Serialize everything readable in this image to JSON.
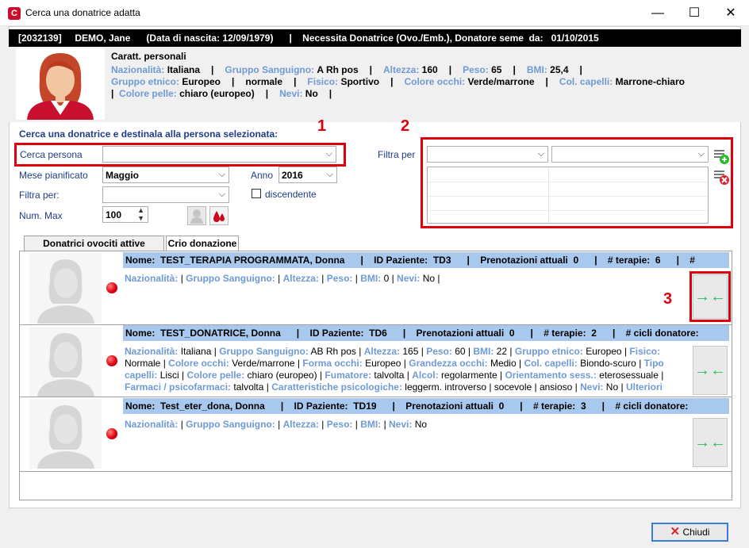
{
  "window": {
    "title": "Cerca una donatrice adatta",
    "minimize": "—",
    "maximize": "☐",
    "close": "✕"
  },
  "header": {
    "text": "[2032139]     DEMO, Jane      (Data di nascita: 12/09/1979)      |    Necessita Donatrice (Ovo./Emb.), Donatore seme  da:   01/10/2015"
  },
  "person": {
    "title": "Caratt. personali",
    "nazionalita_label": "Nazionalità:",
    "nazionalita": "Italiana",
    "gruppo_label": "Gruppo Sanguigno:",
    "gruppo": "A Rh pos",
    "altezza_label": "Altezza:",
    "altezza": "160",
    "peso_label": "Peso:",
    "peso": "65",
    "bmi_label": "BMI:",
    "bmi": "25,4",
    "etnico_label": "Gruppo etnico:",
    "etnico": "Europeo",
    "normale": "normale",
    "fisico_label": "Fisico:",
    "fisico": "Sportivo",
    "occhi_label": "Colore occhi:",
    "occhi": "Verde/marrone",
    "capelli_label": "Col. capelli:",
    "capelli": "Marrone-chiaro",
    "pelle_label": "Colore pelle:",
    "pelle": "chiaro (europeo)",
    "nevi_label": "Nevi:",
    "nevi": "No",
    "sep": "|"
  },
  "search": {
    "section_title": "Cerca una donatrice e destinala alla persona selezionata:",
    "cerca_persona_label": "Cerca persona",
    "mese_label": "Mese pianificato",
    "mese_value": "Maggio",
    "anno_label": "Anno",
    "anno_value": "2016",
    "filtra_label": "Filtra per:",
    "discendente_label": "discendente",
    "nummax_label": "Num. Max",
    "nummax_value": "100",
    "filtra_per_label": "Filtra per"
  },
  "annotations": {
    "n1": "1",
    "n2": "2",
    "n3": "3"
  },
  "tabs": [
    {
      "label": "Donatrici ovociti attive"
    },
    {
      "label": "Crio donazione"
    }
  ],
  "rows": [
    {
      "header": "Nome:  TEST_TERAPIA PROGRAMMATA, Donna      |    ID Paziente:  TD3      |    Prenotazioni attuali  0      |    # terapie:  6      |    #",
      "line1": [
        [
          "Nazionalità:",
          ""
        ],
        [
          "Gruppo Sanguigno:",
          ""
        ],
        [
          "Altezza:",
          ""
        ],
        [
          "Peso:",
          ""
        ],
        [
          "BMI:",
          "0"
        ],
        [
          "Nevi:",
          "No"
        ]
      ]
    },
    {
      "header": "Nome:  TEST_DONATRICE, Donna      |    ID Paziente:  TD6      |    Prenotazioni attuali  0      |    # terapie:  2      |    # cicli donatore:",
      "details": [
        [
          "Nazionalità:",
          "Italiana"
        ],
        [
          "Gruppo Sanguigno:",
          "AB Rh pos"
        ],
        [
          "Altezza:",
          "165"
        ],
        [
          "Peso:",
          "60"
        ],
        [
          "BMI:",
          "22"
        ],
        [
          "Gruppo etnico:",
          "Europeo"
        ],
        [
          "Fisico:",
          "Normale"
        ],
        [
          "Colore occhi:",
          "Verde/marrone"
        ],
        [
          "Forma occhi:",
          "Europeo"
        ],
        [
          "Grandezza occhi:",
          "Medio"
        ],
        [
          "Col. capelli:",
          "Biondo-scuro"
        ],
        [
          "Tipo capelli:",
          "Lisci"
        ],
        [
          "Colore pelle:",
          "chiaro (europeo)"
        ],
        [
          "Fumatore:",
          "talvolta"
        ],
        [
          "Alcol:",
          "regolarmente"
        ],
        [
          "Orientamento sess.:",
          "eterosessuale"
        ],
        [
          "Farmaci / psicofarmaci:",
          "talvolta"
        ],
        [
          "Caratteristiche psicologiche:",
          "leggerm. introverso  | socevole  | ansioso"
        ],
        [
          "Nevi:",
          "No"
        ],
        [
          "Ulteriori",
          ""
        ]
      ]
    },
    {
      "header": "Nome:  Test_eter_dona, Donna      |    ID Paziente:  TD19      |    Prenotazioni attuali  0      |    # terapie:  3      |    # cicli donatore:",
      "line1": [
        [
          "Nazionalità:",
          ""
        ],
        [
          "Gruppo Sanguigno:",
          ""
        ],
        [
          "Altezza:",
          ""
        ],
        [
          "Peso:",
          ""
        ],
        [
          "BMI:",
          ""
        ],
        [
          "Nevi:",
          "No"
        ]
      ]
    }
  ],
  "footer": {
    "close_label": "Chiudi"
  },
  "colors": {
    "accent_blue": "#a9c8ee",
    "label_blue": "#6e9ad6",
    "annotation_red": "#e0000d",
    "assign_green": "#2bbf5a"
  }
}
